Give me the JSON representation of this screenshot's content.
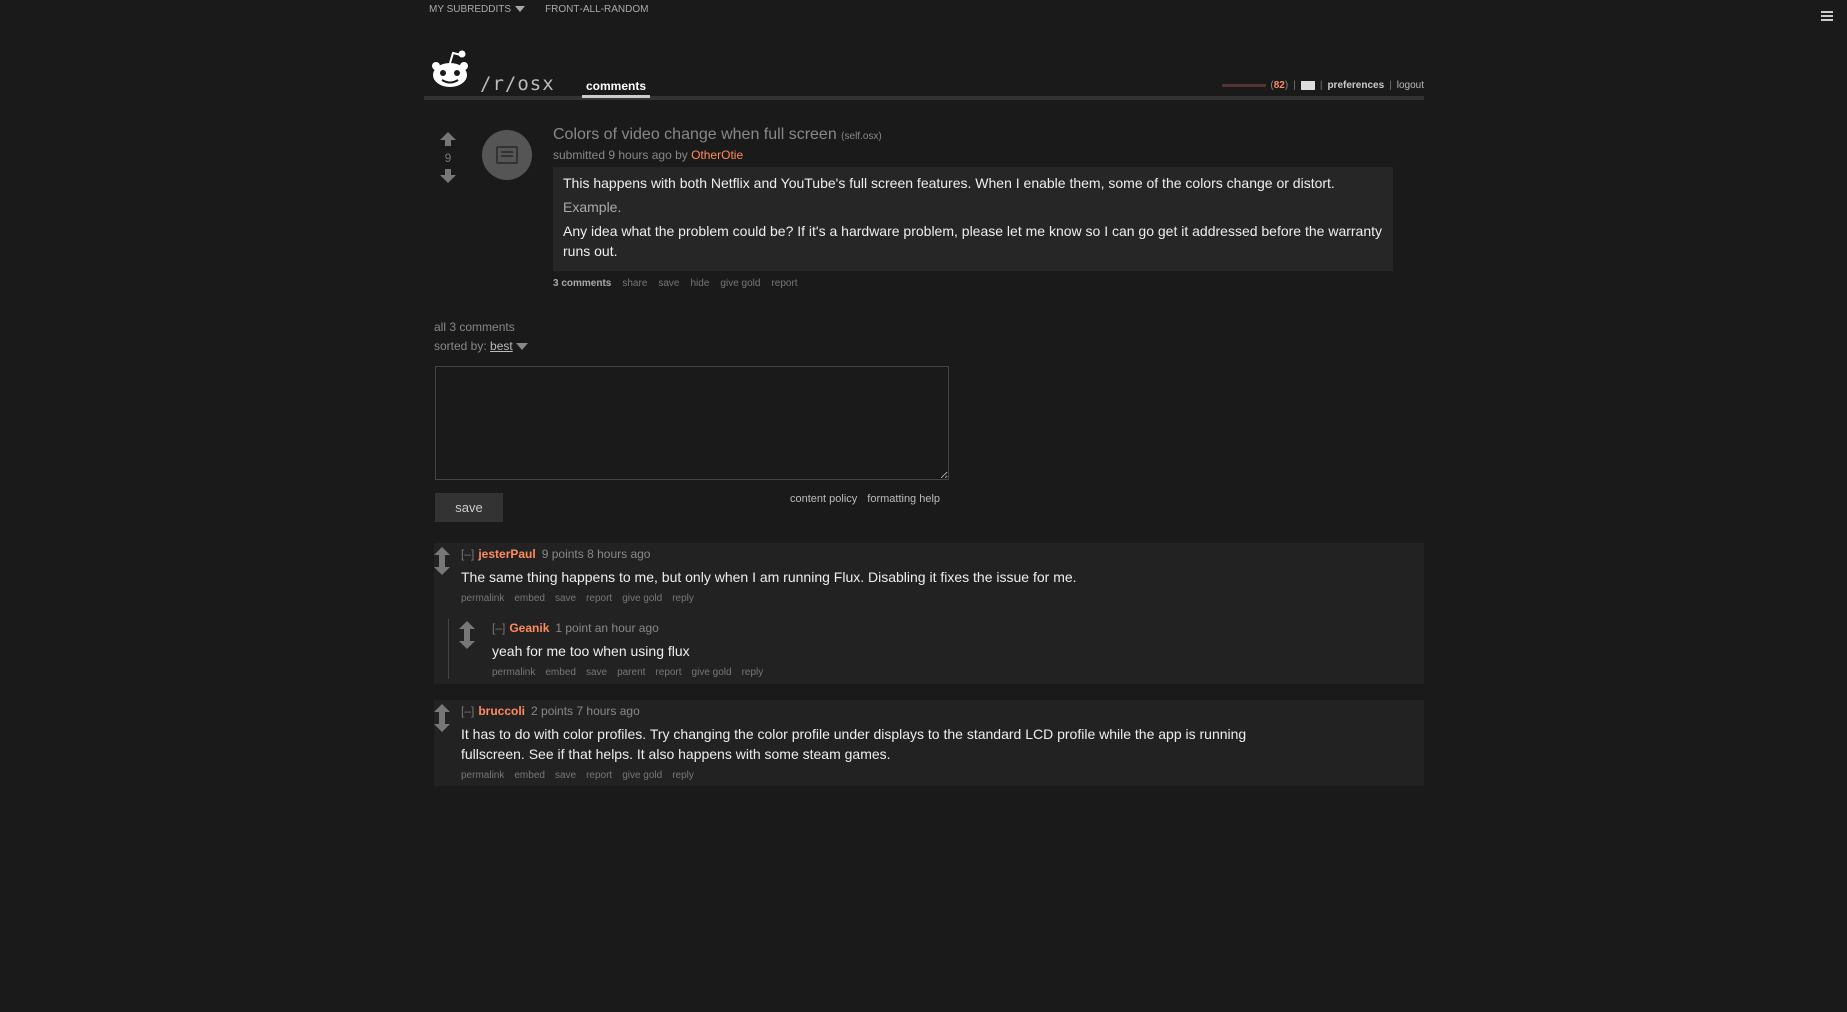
{
  "topbar": {
    "my_subreddits": "MY SUBREDDITS",
    "front": "FRONT",
    "all": "ALL",
    "random": "RANDOM",
    "dash": " - "
  },
  "header": {
    "subreddit": "/r/osx",
    "tab": "comments",
    "karma": "82",
    "preferences": "preferences",
    "logout": "logout",
    "sep": "|"
  },
  "post": {
    "score": "9",
    "title": "Colors of video change when full screen",
    "domain": "(self.osx)",
    "submitted": "submitted 9 hours ago by",
    "author": "OtherOtie",
    "body_1": "This happens with both Netflix and YouTube's full screen features. When I enable them, some of the colors change or distort.",
    "body_link": "Example.",
    "body_2": "Any idea what the problem could be? If it's a hardware problem, please let me know so I can go get it addressed before the warranty runs out.",
    "buttons": {
      "comments": "3 comments",
      "share": "share",
      "save": "save",
      "hide": "hide",
      "give_gold": "give gold",
      "report": "report"
    }
  },
  "comments_section": {
    "all_comments": "all 3 comments",
    "sorted_by": "sorted by:",
    "sort_value": "best",
    "save_button": "save",
    "content_policy": "content policy",
    "formatting_help": "formatting help"
  },
  "comments": [
    {
      "expand": "[–]",
      "author": "jesterPaul",
      "meta": "9 points 8 hours ago",
      "text": "The same thing happens to me, but only when I am running Flux. Disabling it fixes the issue for me.",
      "buttons": [
        "permalink",
        "embed",
        "save",
        "report",
        "give gold",
        "reply"
      ]
    },
    {
      "expand": "[–]",
      "author": "Geanik",
      "meta": "1 point an hour ago",
      "text": "yeah for me too when using flux",
      "buttons": [
        "permalink",
        "embed",
        "save",
        "parent",
        "report",
        "give gold",
        "reply"
      ]
    },
    {
      "expand": "[–]",
      "author": "bruccoli",
      "meta": "2 points 7 hours ago",
      "text_1": "It has to do with color profiles. Try changing the color profile under displays to the standard LCD profile while the app is running",
      "text_2": "fullscreen. See if that helps. It also happens with some steam games.",
      "buttons": [
        "permalink",
        "embed",
        "save",
        "report",
        "give gold",
        "reply"
      ]
    }
  ],
  "colors": {
    "background": "#1a1a1a",
    "accent_author": "#ff8b60",
    "panel": "#222222"
  }
}
